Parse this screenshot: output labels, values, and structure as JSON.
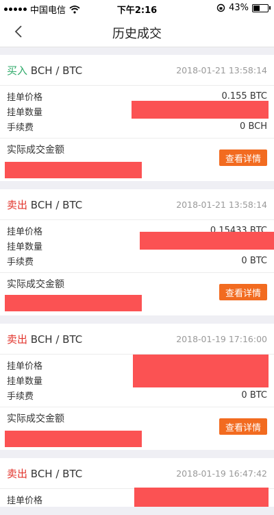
{
  "status_bar": {
    "carrier": "中国电信",
    "time": "下午2:16",
    "battery": "43%",
    "battery_level": 0.43
  },
  "nav": {
    "title": "历史成交"
  },
  "labels": {
    "order_price": "挂单价格",
    "order_qty": "挂单数量",
    "fee": "手续费",
    "amount": "实际成交金额",
    "detail_button": "查看详情"
  },
  "orders": [
    {
      "side": "买入",
      "side_type": "buy",
      "pair": "BCH / BTC",
      "time": "2018-01-21 13:58:14",
      "price": "0.155 BTC",
      "qty": "",
      "fee": "0 BCH",
      "amount": ""
    },
    {
      "side": "卖出",
      "side_type": "sell",
      "pair": "BCH / BTC",
      "time": "2018-01-21 13:58:14",
      "price": "0.15433 BTC",
      "qty": "",
      "fee": "0 BTC",
      "amount": ""
    },
    {
      "side": "卖出",
      "side_type": "sell",
      "pair": "BCH / BTC",
      "time": "2018-01-19 17:16:00",
      "price": "",
      "qty": "",
      "fee": "0 BTC",
      "amount": ""
    },
    {
      "side": "卖出",
      "side_type": "sell",
      "pair": "BCH / BTC",
      "time": "2018-01-19 16:47:42",
      "price": "",
      "qty": "",
      "fee": "",
      "amount": ""
    }
  ],
  "colors": {
    "buy": "#2faa6a",
    "sell": "#e2342c",
    "button": "#f26b20",
    "redaction": "#fb5253"
  }
}
